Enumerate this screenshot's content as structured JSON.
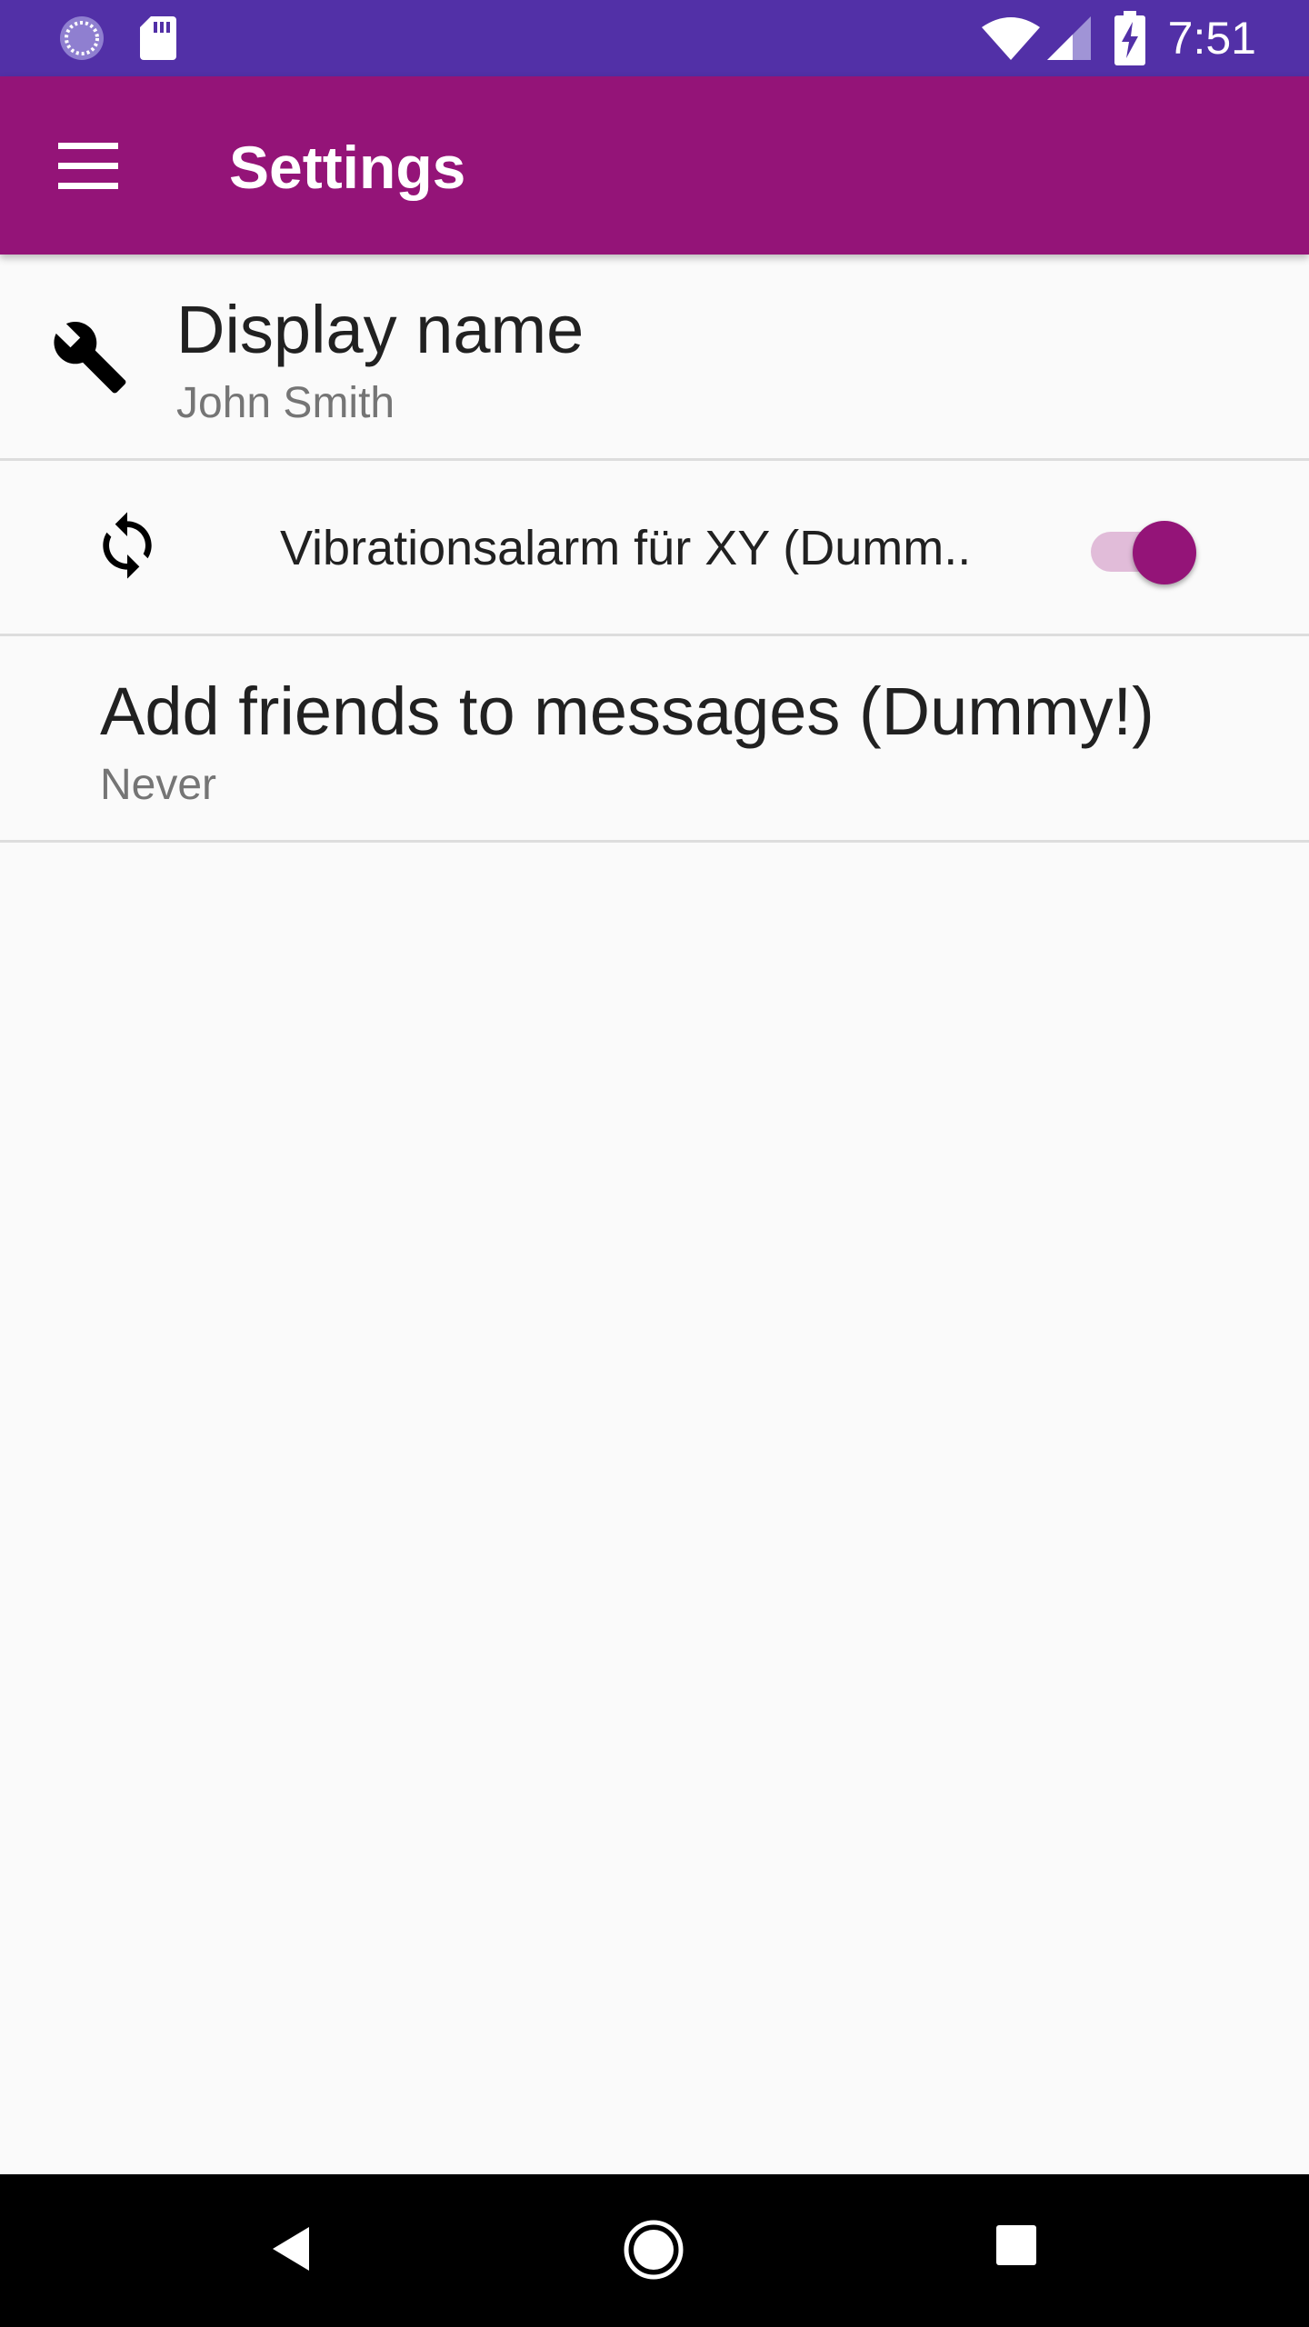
{
  "status_bar": {
    "time": "7:51",
    "background": "#5230a7",
    "icons": [
      "sync-progress-icon",
      "sd-card-icon",
      "wifi-icon",
      "cell-signal-icon",
      "battery-charging-icon"
    ]
  },
  "app_bar": {
    "title": "Settings",
    "background": "#941478",
    "menu_icon": "menu-icon"
  },
  "preferences": [
    {
      "icon": "wrench-icon",
      "title": "Display name",
      "summary": "John Smith"
    },
    {
      "icon": "sync-icon",
      "title": "Vibrationsalarm für XY (Dumm..",
      "toggle_on": true
    },
    {
      "title": "Add friends to messages (Dummy!)",
      "summary": "Never"
    }
  ],
  "colors": {
    "accent": "#941478",
    "toggle_track": "#e1bcd9",
    "background": "#fafafa",
    "divider": "#dddddd"
  },
  "nav_bar": {
    "buttons": [
      "back-icon",
      "home-icon",
      "recents-icon"
    ]
  }
}
